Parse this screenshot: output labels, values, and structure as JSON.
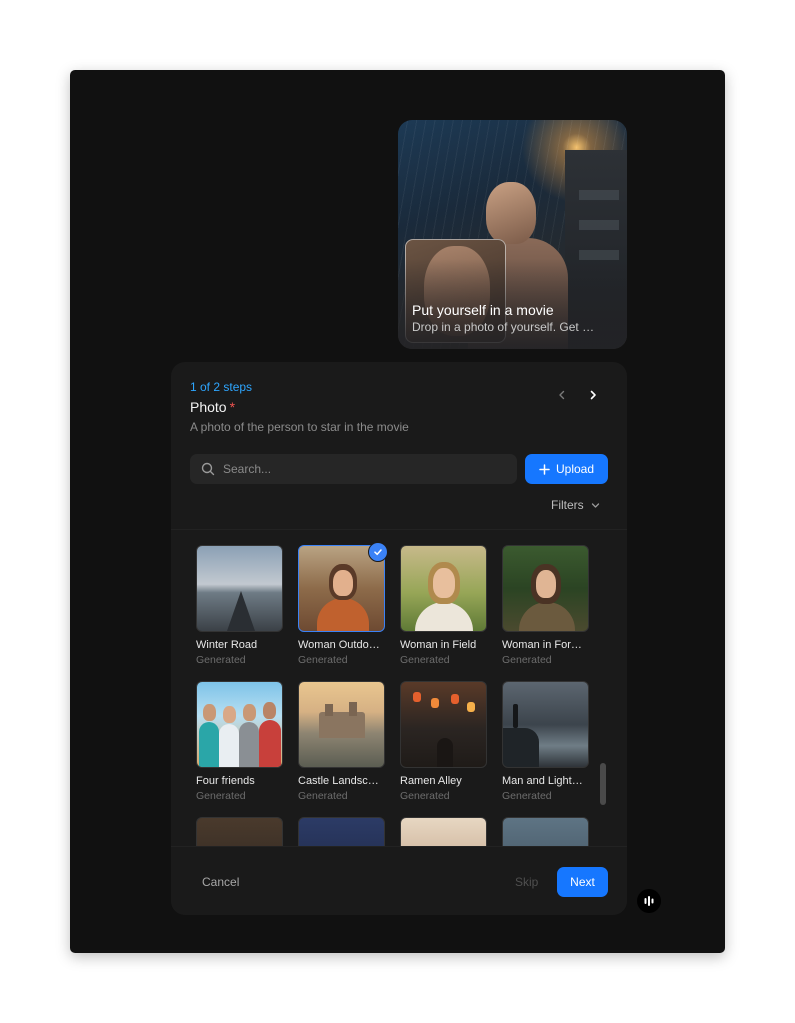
{
  "movie_card": {
    "title": "Put yourself in a movie",
    "subtitle": "Drop in a photo of yourself. Get …"
  },
  "step": {
    "counter": "1 of 2 steps",
    "field_title": "Photo",
    "required_mark": "*",
    "description": "A photo of the person to star in the movie"
  },
  "search": {
    "placeholder": "Search..."
  },
  "upload_label": "Upload",
  "filters_label": "Filters",
  "gallery": {
    "items": [
      {
        "name": "Winter Road",
        "sub": "Generated",
        "selected": false
      },
      {
        "name": "Woman Outdo…",
        "sub": "Generated",
        "selected": true
      },
      {
        "name": "Woman in Field",
        "sub": "Generated",
        "selected": false
      },
      {
        "name": "Woman in For…",
        "sub": "Generated",
        "selected": false
      },
      {
        "name": "Four friends",
        "sub": "Generated",
        "selected": false
      },
      {
        "name": "Castle Landsc…",
        "sub": "Generated",
        "selected": false
      },
      {
        "name": "Ramen Alley",
        "sub": "Generated",
        "selected": false
      },
      {
        "name": "Man and Light…",
        "sub": "Generated",
        "selected": false
      }
    ]
  },
  "footer": {
    "cancel_label": "Cancel",
    "skip_label": "Skip",
    "next_label": "Next"
  },
  "colors": {
    "accent": "#1677ff",
    "step_counter": "#2ea6ff",
    "required": "#ef5350"
  },
  "icons": {
    "search": "search-icon",
    "upload": "plus-icon",
    "prev": "chevron-left-icon",
    "next": "chevron-right-icon",
    "filters": "chevron-down-icon",
    "selected": "check-icon",
    "widget": "waveform-icon"
  }
}
